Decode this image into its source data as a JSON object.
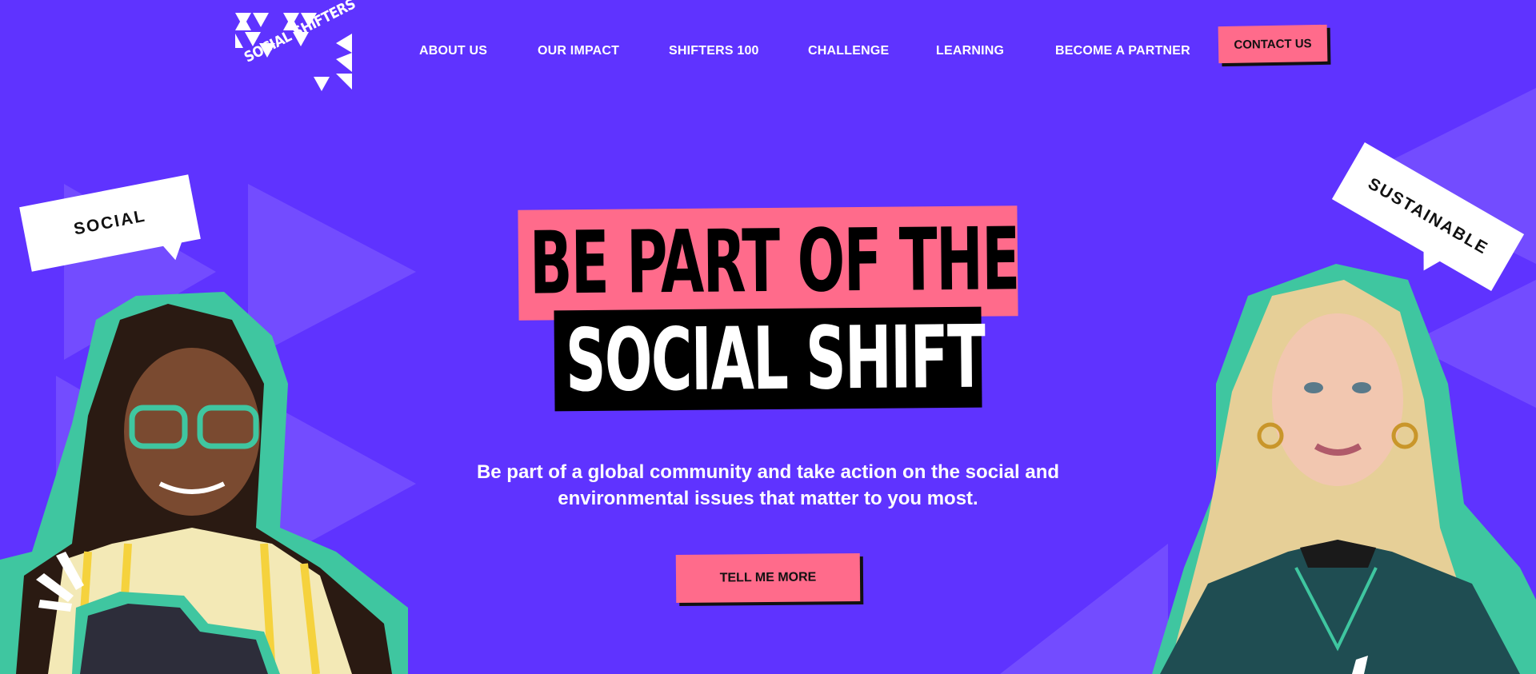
{
  "header": {
    "logo_text": "SOCIAL SHIFTERS",
    "nav": [
      {
        "label": "ABOUT US"
      },
      {
        "label": "OUR IMPACT"
      },
      {
        "label": "SHIFTERS 100"
      },
      {
        "label": "CHALLENGE"
      },
      {
        "label": "LEARNING"
      },
      {
        "label": "BECOME A PARTNER"
      }
    ],
    "contact_label": "CONTACT US"
  },
  "hero": {
    "headline_line1": "BE PART OF THE",
    "headline_line2": "SOCIAL SHIFT",
    "subtitle_line1": "Be part of a global community and take action on the social and",
    "subtitle_line2": "environmental issues that matter to you most.",
    "cta_label": "TELL ME MORE"
  },
  "bubbles": {
    "left": "SOCIAL",
    "right": "SUSTAINABLE"
  },
  "colors": {
    "background": "#5f33ff",
    "accent_pink": "#ff6b8b",
    "teal": "#3fc6a0",
    "black": "#000000",
    "white": "#ffffff"
  }
}
